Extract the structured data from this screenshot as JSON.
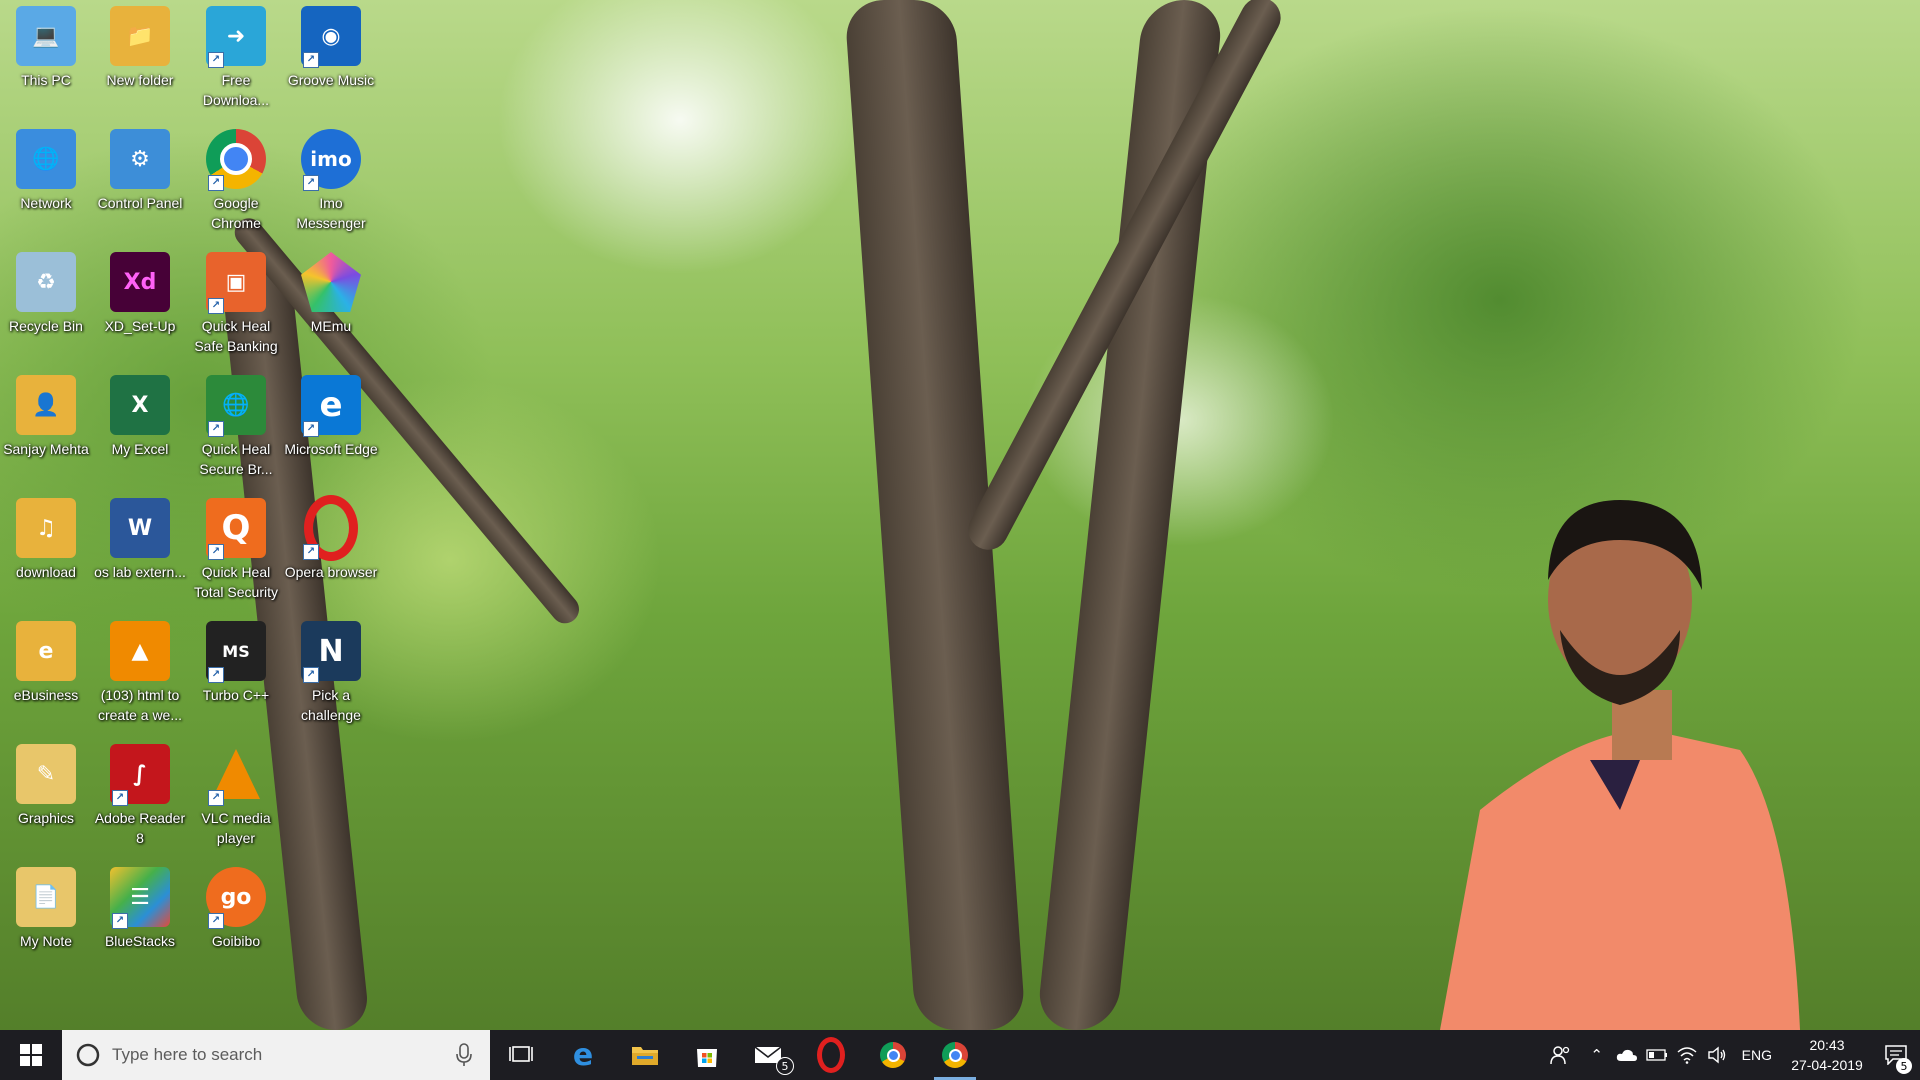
{
  "desktop": {
    "icons": [
      {
        "label": "This PC",
        "icon": "this-pc-icon",
        "color": "#5aa9e6"
      },
      {
        "label": "New folder",
        "icon": "folder-icon",
        "color": "#e8b23c"
      },
      {
        "label": "Free Downloa...",
        "icon": "free-download-manager-icon",
        "color": "#2aa6d8"
      },
      {
        "label": "Groove Music",
        "icon": "groove-music-icon",
        "color": "#1565c0"
      },
      {
        "label": "Network",
        "icon": "network-icon",
        "color": "#3a8dde"
      },
      {
        "label": "Control Panel",
        "icon": "control-panel-icon",
        "color": "#3d8ed8"
      },
      {
        "label": "Google Chrome",
        "icon": "chrome-icon",
        "color": "#db4437"
      },
      {
        "label": "Imo Messenger",
        "icon": "imo-icon",
        "color": "#1e6fd6"
      },
      {
        "label": "Recycle Bin",
        "icon": "recycle-bin-icon",
        "color": "#9bbfd8"
      },
      {
        "label": "XD_Set-Up",
        "icon": "adobe-xd-icon",
        "color": "#470137"
      },
      {
        "label": "Quick Heal Safe Banking",
        "icon": "quick-heal-safe-banking-icon",
        "color": "#e8632c"
      },
      {
        "label": "MEmu",
        "icon": "memu-icon",
        "color": "#7b4ce0"
      },
      {
        "label": "Sanjay Mehta",
        "icon": "user-folder-icon",
        "color": "#e8b23c"
      },
      {
        "label": "My Excel",
        "icon": "excel-icon",
        "color": "#1f7244"
      },
      {
        "label": "Quick Heal Secure Br...",
        "icon": "quick-heal-secure-browser-icon",
        "color": "#2c8a3a"
      },
      {
        "label": "Microsoft Edge",
        "icon": "edge-icon",
        "color": "#0a78d6"
      },
      {
        "label": "download",
        "icon": "download-folder-icon",
        "color": "#e8b23c"
      },
      {
        "label": "os lab extern...",
        "icon": "word-icon",
        "color": "#2b579a"
      },
      {
        "label": "Quick Heal Total Security",
        "icon": "quick-heal-total-security-icon",
        "color": "#ef6c1e"
      },
      {
        "label": "Opera browser",
        "icon": "opera-icon",
        "color": "#e0201f"
      },
      {
        "label": "eBusiness",
        "icon": "ebusiness-folder-icon",
        "color": "#e8b23c"
      },
      {
        "label": "(103) html to create a we...",
        "icon": "vlc-file-icon",
        "color": "#f08a00"
      },
      {
        "label": "Turbo C++",
        "icon": "turbo-cpp-icon",
        "color": "#222222"
      },
      {
        "label": "Pick a challenge",
        "icon": "pick-a-challenge-icon",
        "color": "#1b3a5c"
      },
      {
        "label": "Graphics",
        "icon": "graphics-folder-icon",
        "color": "#e8b23c"
      },
      {
        "label": "Adobe Reader 8",
        "icon": "adobe-reader-icon",
        "color": "#c4161c"
      },
      {
        "label": "VLC media player",
        "icon": "vlc-icon",
        "color": "#f08a00"
      },
      {
        "label": "My Note",
        "icon": "my-note-folder-icon",
        "color": "#e8c66a"
      },
      {
        "label": "BlueStacks",
        "icon": "bluestacks-icon",
        "color": "#46b04a"
      },
      {
        "label": "Goibibo",
        "icon": "goibibo-icon",
        "color": "#ef6c1e"
      }
    ]
  },
  "taskbar": {
    "search_placeholder": "Type here to search",
    "apps": [
      {
        "name": "task-view",
        "icon": "task-view-icon"
      },
      {
        "name": "edge",
        "icon": "edge-icon"
      },
      {
        "name": "file-explorer",
        "icon": "folder-icon"
      },
      {
        "name": "store",
        "icon": "store-icon"
      },
      {
        "name": "mail",
        "icon": "mail-icon",
        "badge": "5"
      },
      {
        "name": "opera",
        "icon": "opera-icon"
      },
      {
        "name": "chrome",
        "icon": "chrome-icon"
      },
      {
        "name": "chrome-active",
        "icon": "chrome-icon"
      }
    ],
    "tray": {
      "language": "ENG",
      "time": "20:43",
      "date": "27-04-2019",
      "notification_count": "5"
    }
  }
}
